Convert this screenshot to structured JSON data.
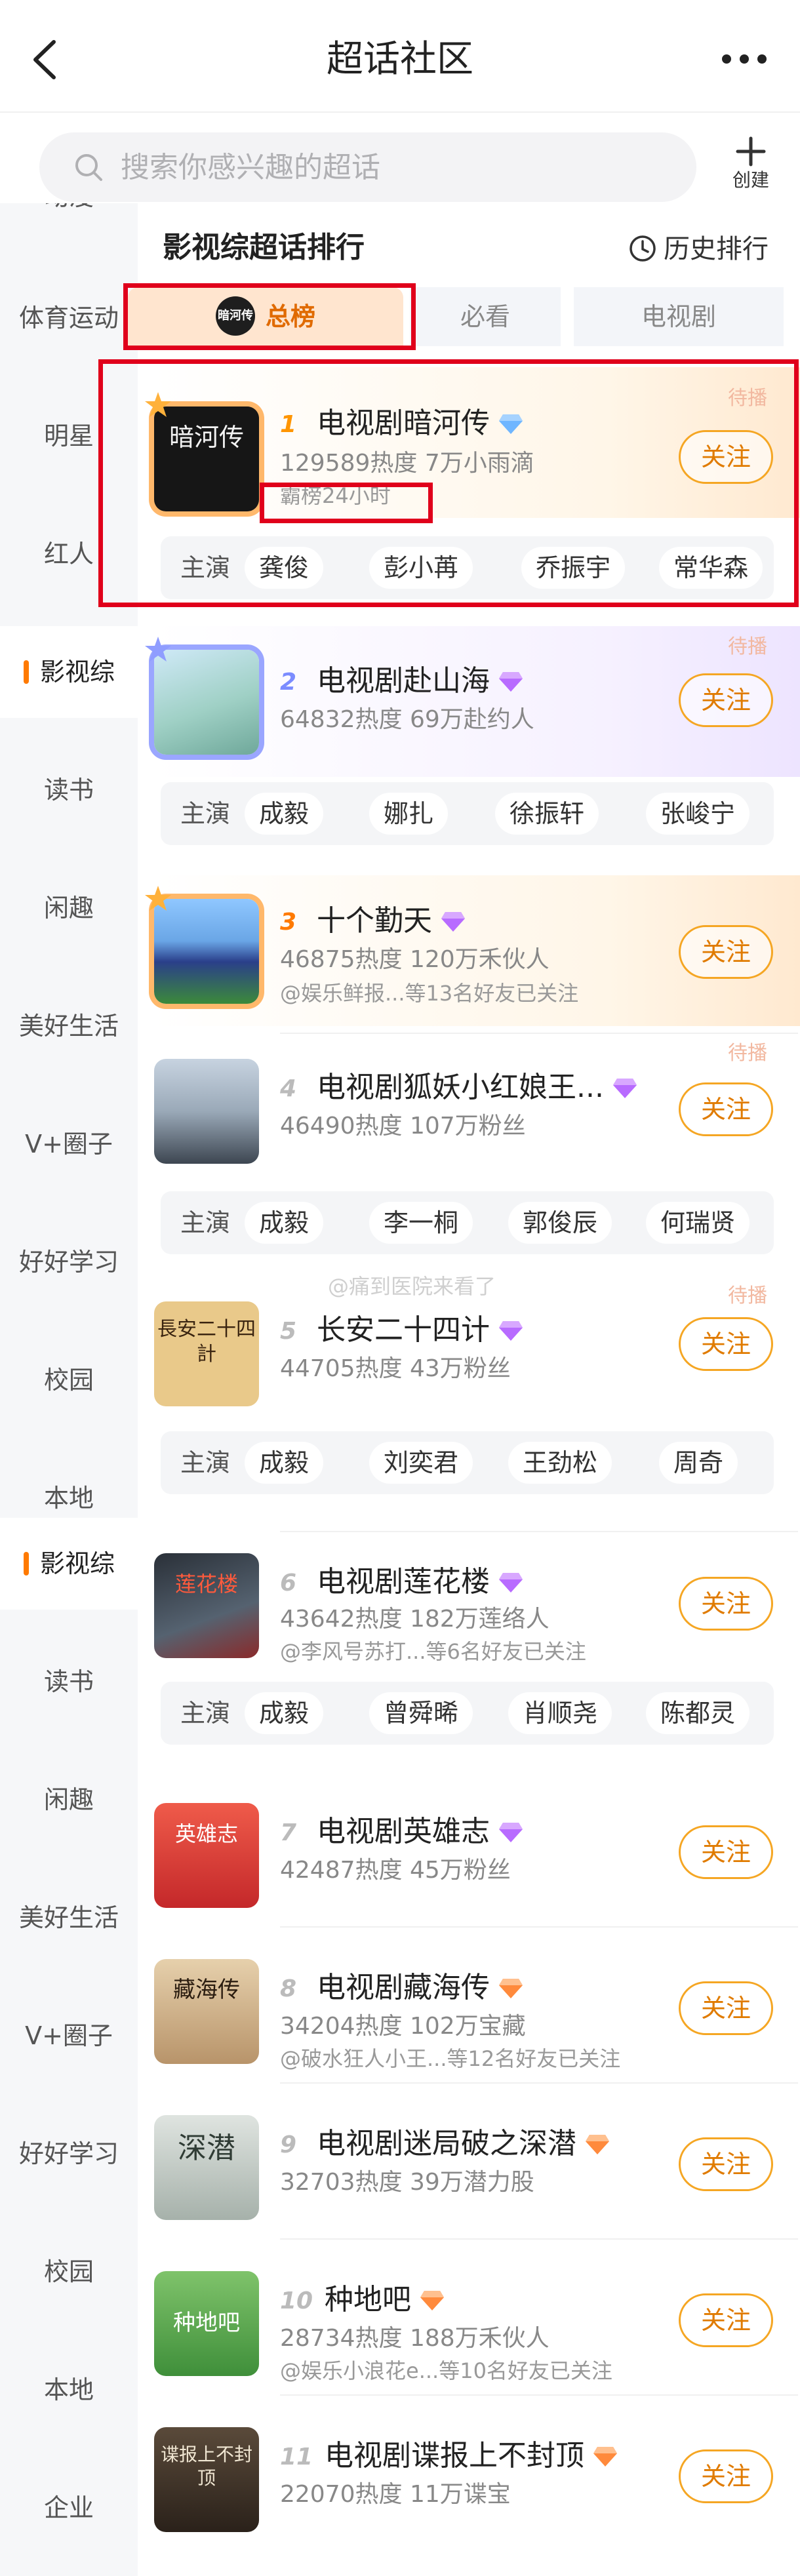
{
  "header": {
    "title": "超话社区"
  },
  "search": {
    "placeholder": "搜索你感兴趣的超话",
    "create_label": "创建"
  },
  "sidebar": {
    "items": [
      "动漫",
      "体育运动",
      "明星",
      "红人",
      "影视综",
      "读书",
      "闲趣",
      "美好生活",
      "V+圈子",
      "好好学习",
      "校园",
      "本地",
      "影视综",
      "读书",
      "闲趣",
      "美好生活",
      "V+圈子",
      "好好学习",
      "校园",
      "本地",
      "企业"
    ]
  },
  "ranking": {
    "title": "影视综超话排行",
    "history_label": "历史排行",
    "tabs": [
      "总榜",
      "必看",
      "电视剧"
    ],
    "tab_logo_text": "暗河传"
  },
  "items": [
    {
      "rank": "1",
      "name": "电视剧暗河传",
      "stats": "129589热度 7万小雨滴",
      "tag": "霸榜24小时",
      "pending": "待播",
      "cover_text": "暗河传",
      "cast_lead": "主演",
      "cast": [
        "龚俊",
        "彭小苒",
        "乔振宇",
        "常华森"
      ]
    },
    {
      "rank": "2",
      "name": "电视剧赴山海",
      "stats": "64832热度 69万赴约人",
      "pending": "待播",
      "cover_text": "",
      "cast_lead": "主演",
      "cast": [
        "成毅",
        "娜扎",
        "徐振轩",
        "张峻宁"
      ]
    },
    {
      "rank": "3",
      "name": "十个勤天",
      "stats": "46875热度 120万禾伙人",
      "friends": "@娱乐鲜报...等13名好友已关注",
      "cover_text": ""
    },
    {
      "rank": "4",
      "name": "电视剧狐妖小红娘王...",
      "stats": "46490热度 107万粉丝",
      "pending": "待播",
      "cover_text": "",
      "cast_lead": "主演",
      "cast": [
        "成毅",
        "李一桐",
        "郭俊辰",
        "何瑞贤"
      ]
    },
    {
      "rank": "5",
      "name": "长安二十四计",
      "stats": "44705热度 43万粉丝",
      "pending": "待播",
      "cover_text": "長安二十四計",
      "cast_lead": "主演",
      "cast": [
        "成毅",
        "刘奕君",
        "王劲松",
        "周奇"
      ]
    },
    {
      "rank": "6",
      "name": "电视剧莲花楼",
      "stats": "43642热度 182万莲络人",
      "friends": "@李风号苏打...等6名好友已关注",
      "cover_text": "莲花楼",
      "cast_lead": "主演",
      "cast": [
        "成毅",
        "曾舜晞",
        "肖顺尧",
        "陈都灵"
      ]
    },
    {
      "rank": "7",
      "name": "电视剧英雄志",
      "stats": "42487热度 45万粉丝",
      "cover_text": "英雄志"
    },
    {
      "rank": "8",
      "name": "电视剧藏海传",
      "stats": "34204热度 102万宝藏",
      "friends": "@破水狂人小王...等12名好友已关注",
      "cover_text": "藏海传"
    },
    {
      "rank": "9",
      "name": "电视剧迷局破之深潜",
      "stats": "32703热度 39万潜力股",
      "cover_text": "深潜"
    },
    {
      "rank": "10",
      "name": "种地吧",
      "stats": "28734热度 188万禾伙人",
      "friends": "@娱乐小浪花e...等10名好友已关注",
      "cover_text": "种地吧"
    },
    {
      "rank": "11",
      "name": "电视剧谍报上不封顶",
      "stats": "22070热度 11万谍宝",
      "cover_text": "谍报上不封顶"
    }
  ],
  "follow_label": "关注",
  "watermark": "@痛到医院来看了",
  "colors": {
    "accent": "#ff7a00",
    "follow_border": "#f5a623",
    "highlight": "#e0001b"
  }
}
